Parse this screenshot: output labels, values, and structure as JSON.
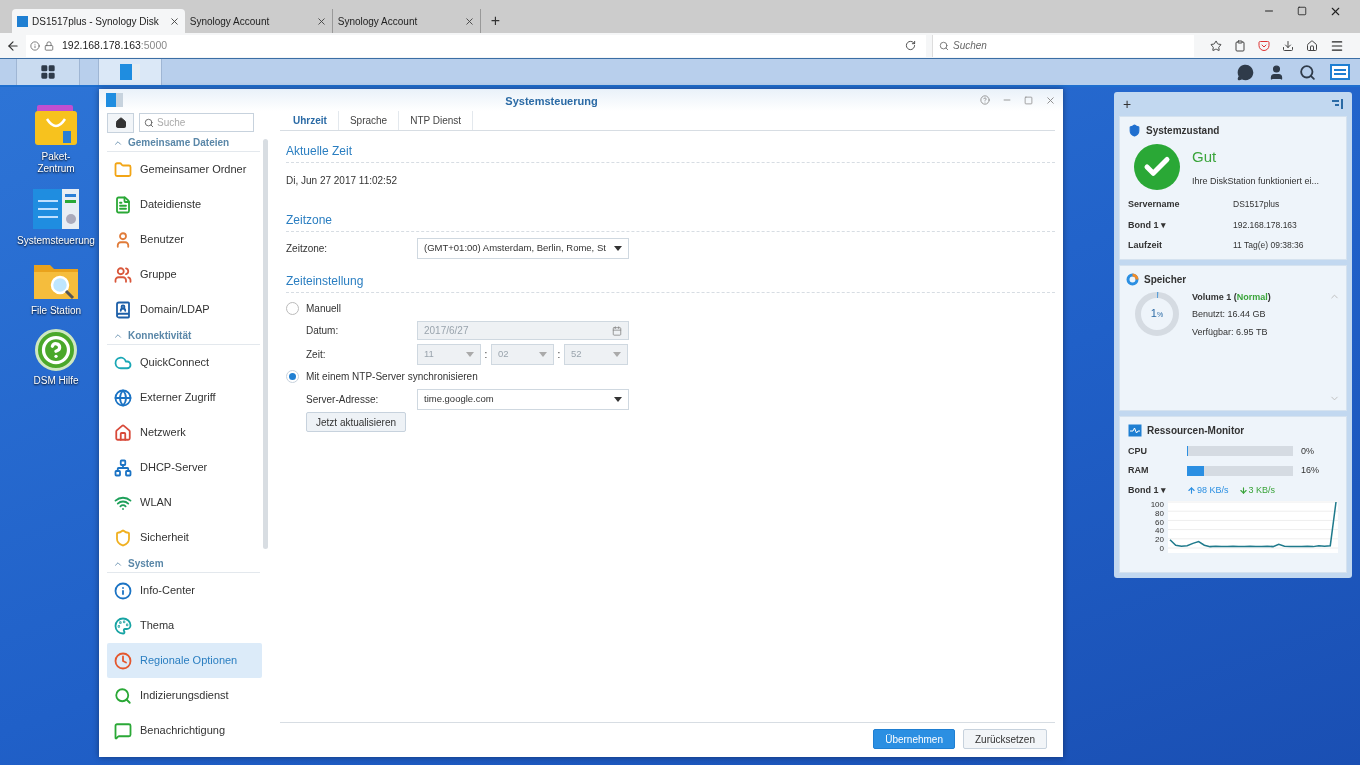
{
  "browser": {
    "tabs": [
      {
        "title": "DS1517plus - Synology Disk",
        "selected": true
      },
      {
        "title": "Synology Account",
        "selected": false
      },
      {
        "title": "Synology Account",
        "selected": false
      }
    ],
    "new_tab": "+",
    "url": {
      "host": "192.168.178.163",
      "port": ":5000"
    },
    "search": {
      "placeholder": "Suchen"
    }
  },
  "taskbar": {
    "buttons": [
      {
        "kind": "main-menu",
        "selected": false
      },
      {
        "kind": "control-panel",
        "selected": true
      }
    ]
  },
  "desktop": {
    "shortcuts": [
      {
        "label": "Paket-Zentrum",
        "kind": "package"
      },
      {
        "label": "Systemsteuerung",
        "kind": "control"
      },
      {
        "label": "File Station",
        "kind": "files"
      },
      {
        "label": "DSM Hilfe",
        "kind": "help"
      }
    ]
  },
  "window": {
    "title": "Systemsteuerung",
    "search": {
      "placeholder": "Suche"
    },
    "sidebar": [
      {
        "title": "Gemeinsame Dateien",
        "items": [
          {
            "label": "Gemeinsamer Ordner",
            "kind": "folder",
            "selected": false
          },
          {
            "label": "Dateidienste",
            "kind": "file",
            "selected": false
          },
          {
            "label": "Benutzer",
            "kind": "user",
            "selected": false
          },
          {
            "label": "Gruppe",
            "kind": "users",
            "selected": false
          },
          {
            "label": "Domain/LDAP",
            "kind": "book",
            "selected": false
          }
        ]
      },
      {
        "title": "Konnektivität",
        "items": [
          {
            "label": "QuickConnect",
            "kind": "cloud",
            "selected": false
          },
          {
            "label": "Externer Zugriff",
            "kind": "globe",
            "selected": false
          },
          {
            "label": "Netzwerk",
            "kind": "house",
            "selected": false
          },
          {
            "label": "DHCP-Server",
            "kind": "network",
            "selected": false
          },
          {
            "label": "WLAN",
            "kind": "wifi",
            "selected": false
          },
          {
            "label": "Sicherheit",
            "kind": "shield",
            "selected": false
          }
        ]
      },
      {
        "title": "System",
        "items": [
          {
            "label": "Info-Center",
            "kind": "info",
            "selected": false
          },
          {
            "label": "Thema",
            "kind": "palette",
            "selected": false
          },
          {
            "label": "Regionale Optionen",
            "kind": "clock",
            "selected": true
          },
          {
            "label": "Indizierungsdienst",
            "kind": "search",
            "selected": false
          },
          {
            "label": "Benachrichtigung",
            "kind": "message",
            "selected": false
          }
        ]
      }
    ],
    "tabs": [
      {
        "label": "Uhrzeit",
        "selected": true
      },
      {
        "label": "Sprache",
        "selected": false
      },
      {
        "label": "NTP Dienst",
        "selected": false
      }
    ],
    "current_time": {
      "heading": "Aktuelle Zeit",
      "value": "Di, Jun 27 2017 11:02:52"
    },
    "timezone": {
      "heading": "Zeitzone",
      "label": "Zeitzone:",
      "value": "(GMT+01:00) Amsterdam, Berlin, Rome, St"
    },
    "time_setting": {
      "heading": "Zeiteinstellung",
      "manual": {
        "label": "Manuell",
        "selected": false,
        "date_label": "Datum:",
        "date": "2017/6/27",
        "time_label": "Zeit:",
        "hour": "11",
        "minute": "02",
        "second": "52",
        "separator": ":",
        "disabled": true
      },
      "ntp": {
        "label": "Mit einem NTP-Server synchronisieren",
        "selected": true,
        "server_label": "Server-Adresse:",
        "server": "time.google.com",
        "update_button": "Jetzt aktualisieren"
      }
    },
    "buttons": [
      {
        "label": "Übernehmen",
        "kind": "primary"
      },
      {
        "label": "Zurücksetzen",
        "kind": "secondary"
      }
    ]
  },
  "widgets": {
    "add": "+",
    "system_status": {
      "title": "Systemzustand",
      "status": "Gut",
      "message": "Ihre DiskStation funktioniert ei...",
      "rows": [
        {
          "label": "Servername",
          "value": "DS1517plus"
        },
        {
          "label": "Bond 1 ▾",
          "value": "192.168.178.163"
        },
        {
          "label": "Laufzeit",
          "value": "11 Tag(e) 09:38:36"
        }
      ]
    },
    "storage": {
      "title": "Speicher",
      "percent": "1",
      "percent_sign": "%",
      "level": 0.01,
      "volume": "Volume 1 (",
      "state": "Normal",
      "volume_end": ")",
      "used": "Benutzt: 16.44 GB",
      "free": "Verfügbar: 6.95 TB"
    },
    "resource_monitor": {
      "title": "Ressourcen-Monitor",
      "meters": [
        {
          "label": "CPU",
          "level": 0,
          "reading": "0%"
        },
        {
          "label": "RAM",
          "level": 0.16,
          "reading": "16%"
        }
      ],
      "interface": "Bond 1 ▾",
      "upload": "98 KB/s",
      "download": "3 KB/s",
      "chart_data": {
        "type": "line",
        "ylim": [
          0,
          100
        ],
        "yticks": [
          0,
          20,
          40,
          60,
          80,
          100
        ],
        "grid": true,
        "series": [
          {
            "color": "#1f7a8c",
            "values": [
              18,
              6,
              4,
              5,
              10,
              14,
              6,
              3,
              4,
              3,
              3,
              4,
              3,
              3,
              4,
              3,
              3,
              4,
              3,
              8,
              4,
              3,
              3,
              3,
              4,
              3,
              5,
              4,
              5,
              100
            ]
          }
        ]
      }
    }
  }
}
